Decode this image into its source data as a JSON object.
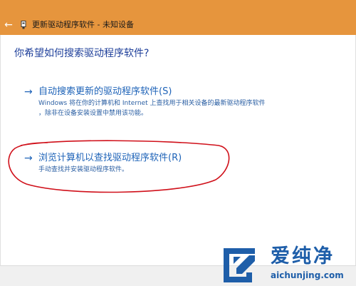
{
  "window": {
    "back_arrow": "←",
    "device_icon": "usb-device-icon",
    "title": "更新驱动程序软件 - 未知设备",
    "titlebar_color": "#e6953d"
  },
  "main": {
    "heading": "你希望如何搜索驱动程序软件?",
    "options": [
      {
        "arrow": "→",
        "label": "自动搜索更新的驱动程序软件(S)",
        "desc_line1": "Windows 将在你的计算机和 Internet 上查找用于相关设备的最新驱动程序软件",
        "desc_line2": "，除非在设备安装设置中禁用该功能。"
      },
      {
        "arrow": "→",
        "label": "浏览计算机以查找驱动程序软件(R)",
        "desc_line1": "手动查找并安装驱动程序软件。"
      }
    ],
    "link_color": "#1e63b8",
    "annotation_color": "#d0101a"
  },
  "watermark": {
    "name": "爱纯净",
    "url": "aichunjing.com",
    "color": "#1e5ea9"
  }
}
